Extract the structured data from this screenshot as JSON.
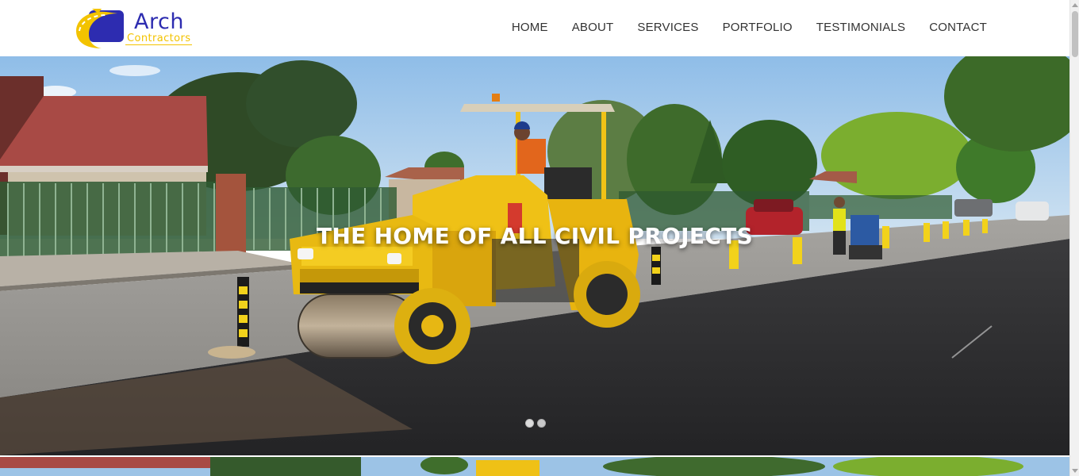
{
  "brand": {
    "name": "Arch",
    "tagline": "Contractors",
    "primary_color": "#2d2cb0",
    "accent_color": "#f3c300"
  },
  "nav": {
    "items": [
      {
        "label": "HOME"
      },
      {
        "label": "ABOUT"
      },
      {
        "label": "SERVICES"
      },
      {
        "label": "PORTFOLIO"
      },
      {
        "label": "TESTIMONIALS"
      },
      {
        "label": "CONTACT"
      }
    ]
  },
  "hero": {
    "title": "THE HOME OF ALL CIVIL PROJECTS",
    "slide_count": 2,
    "active_slide": 1,
    "image_subject": "road-roller-paving-street-photo"
  },
  "icons": {
    "logo": "road-logo-icon",
    "scroll_up": "scroll-up-arrow-icon",
    "scroll_down": "scroll-down-arrow-icon"
  }
}
